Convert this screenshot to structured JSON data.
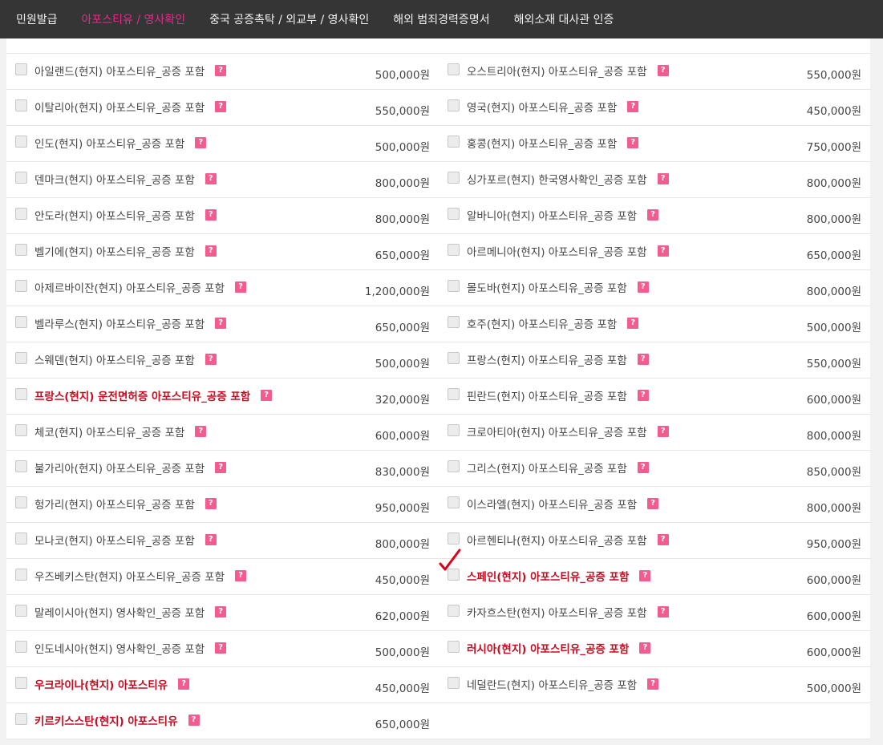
{
  "nav": {
    "items": [
      {
        "label": "민원발급",
        "active": false
      },
      {
        "label": "아포스티유 / 영사확인",
        "active": true
      },
      {
        "label": "중국 공증촉탁 / 외교부 / 영사확인",
        "active": false
      },
      {
        "label": "해외 범죄경력증명서",
        "active": false
      },
      {
        "label": "해외소재 대사관 인증",
        "active": false
      }
    ]
  },
  "colors": {
    "nav_bg": "#353535",
    "nav_active": "#e62b8c",
    "highlight_red": "#c80a1e",
    "help_badge": "#f45b8f",
    "checkmark_red": "#e0001a"
  },
  "help_badge_label": "?",
  "rows": [
    {
      "left": {
        "label": "아일랜드(현지) 아포스티유_공증 포함",
        "price": "500,000원",
        "highlight": false,
        "checked": false
      },
      "right": {
        "label": "오스트리아(현지) 아포스티유_공증 포함",
        "price": "550,000원",
        "highlight": false,
        "checked": false
      }
    },
    {
      "left": {
        "label": "이탈리아(현지) 아포스티유_공증 포함",
        "price": "550,000원",
        "highlight": false,
        "checked": false
      },
      "right": {
        "label": "영국(현지) 아포스티유_공증 포함",
        "price": "450,000원",
        "highlight": false,
        "checked": false
      }
    },
    {
      "left": {
        "label": "인도(현지) 아포스티유_공증 포함",
        "price": "500,000원",
        "highlight": false,
        "checked": false
      },
      "right": {
        "label": "홍콩(현지) 아포스티유_공증 포함",
        "price": "750,000원",
        "highlight": false,
        "checked": false
      }
    },
    {
      "left": {
        "label": "덴마크(현지) 아포스티유_공증 포함",
        "price": "800,000원",
        "highlight": false,
        "checked": false
      },
      "right": {
        "label": "싱가포르(현지) 한국영사확인_공증 포함",
        "price": "800,000원",
        "highlight": false,
        "checked": false
      }
    },
    {
      "left": {
        "label": "안도라(현지) 아포스티유_공증 포함",
        "price": "800,000원",
        "highlight": false,
        "checked": false
      },
      "right": {
        "label": "알바니아(현지) 아포스티유_공증 포함",
        "price": "800,000원",
        "highlight": false,
        "checked": false
      }
    },
    {
      "left": {
        "label": "벨기에(현지) 아포스티유_공증 포함",
        "price": "650,000원",
        "highlight": false,
        "checked": false
      },
      "right": {
        "label": "아르메니아(현지) 아포스티유_공증 포함",
        "price": "650,000원",
        "highlight": false,
        "checked": false
      }
    },
    {
      "left": {
        "label": "아제르바이잔(현지) 아포스티유_공증 포함",
        "price": "1,200,000원",
        "highlight": false,
        "checked": false
      },
      "right": {
        "label": "몰도바(현지) 아포스티유_공증 포함",
        "price": "800,000원",
        "highlight": false,
        "checked": false
      }
    },
    {
      "left": {
        "label": "벨라루스(현지) 아포스티유_공증 포함",
        "price": "650,000원",
        "highlight": false,
        "checked": false
      },
      "right": {
        "label": "호주(현지) 아포스티유_공증 포함",
        "price": "500,000원",
        "highlight": false,
        "checked": false
      }
    },
    {
      "left": {
        "label": "스웨덴(현지) 아포스티유_공증 포함",
        "price": "500,000원",
        "highlight": false,
        "checked": false
      },
      "right": {
        "label": "프랑스(현지) 아포스티유_공증 포함",
        "price": "550,000원",
        "highlight": false,
        "checked": false
      }
    },
    {
      "left": {
        "label": "프랑스(현지) 운전면허증 아포스티유_공증 포함",
        "price": "320,000원",
        "highlight": true,
        "checked": false
      },
      "right": {
        "label": "핀란드(현지) 아포스티유_공증 포함",
        "price": "600,000원",
        "highlight": false,
        "checked": false
      }
    },
    {
      "left": {
        "label": "체코(현지) 아포스티유_공증 포함",
        "price": "600,000원",
        "highlight": false,
        "checked": false
      },
      "right": {
        "label": "크로아티아(현지) 아포스티유_공증 포함",
        "price": "800,000원",
        "highlight": false,
        "checked": false
      }
    },
    {
      "left": {
        "label": "불가리아(현지) 아포스티유_공증 포함",
        "price": "830,000원",
        "highlight": false,
        "checked": false
      },
      "right": {
        "label": "그리스(현지) 아포스티유_공증 포함",
        "price": "850,000원",
        "highlight": false,
        "checked": false
      }
    },
    {
      "left": {
        "label": "헝가리(현지) 아포스티유_공증 포함",
        "price": "950,000원",
        "highlight": false,
        "checked": false
      },
      "right": {
        "label": "이스라엘(현지) 아포스티유_공증 포함",
        "price": "800,000원",
        "highlight": false,
        "checked": false
      }
    },
    {
      "left": {
        "label": "모나코(현지) 아포스티유_공증 포함",
        "price": "800,000원",
        "highlight": false,
        "checked": false
      },
      "right": {
        "label": "아르헨티나(현지) 아포스티유_공증 포함",
        "price": "950,000원",
        "highlight": false,
        "checked": false
      }
    },
    {
      "left": {
        "label": "우즈베키스탄(현지) 아포스티유_공증 포함",
        "price": "450,000원",
        "highlight": false,
        "checked": false
      },
      "right": {
        "label": "스페인(현지) 아포스티유_공증 포함",
        "price": "600,000원",
        "highlight": true,
        "checked": true
      }
    },
    {
      "left": {
        "label": "말레이시아(현지) 영사확인_공증 포함",
        "price": "620,000원",
        "highlight": false,
        "checked": false
      },
      "right": {
        "label": "카자흐스탄(현지) 아포스티유_공증 포함",
        "price": "600,000원",
        "highlight": false,
        "checked": false
      }
    },
    {
      "left": {
        "label": "인도네시아(현지) 영사확인_공증 포함",
        "price": "500,000원",
        "highlight": false,
        "checked": false
      },
      "right": {
        "label": "러시아(현지) 아포스티유_공증 포함",
        "price": "600,000원",
        "highlight": true,
        "checked": false
      }
    },
    {
      "left": {
        "label": "우크라이나(현지) 아포스티유",
        "price": "450,000원",
        "highlight": true,
        "checked": false
      },
      "right": {
        "label": "네덜란드(현지) 아포스티유_공증 포함",
        "price": "500,000원",
        "highlight": false,
        "checked": false
      }
    },
    {
      "left": {
        "label": "키르키스스탄(현지) 아포스티유",
        "price": "650,000원",
        "highlight": true,
        "checked": false
      },
      "right": null
    }
  ]
}
